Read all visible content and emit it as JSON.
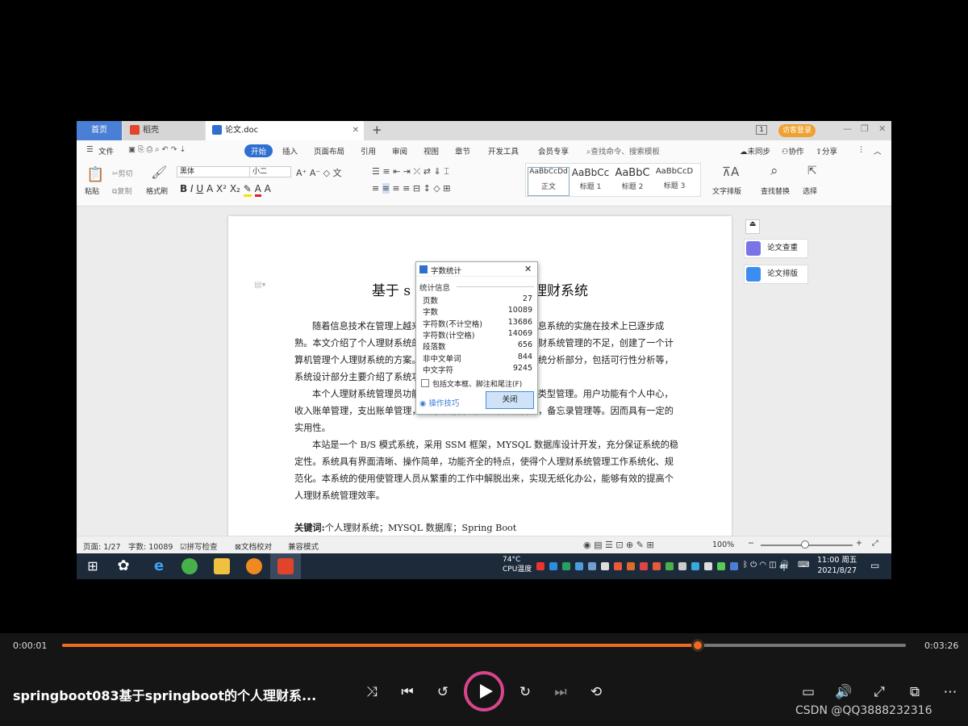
{
  "tabs": {
    "home": "首页",
    "daoke": "稻壳",
    "doc": "论文.doc",
    "login": "访客登录"
  },
  "menu": [
    "文件",
    "开始",
    "插入",
    "页面布局",
    "引用",
    "审阅",
    "视图",
    "章节",
    "开发工具",
    "会员专享"
  ],
  "menu_search": "查找命令、搜索模板",
  "menu_right": {
    "sync": "未同步",
    "collab": "协作",
    "share": "分享"
  },
  "ribbon": {
    "paste": "粘贴",
    "cut": "剪切",
    "copy": "复制",
    "format_painter": "格式刷",
    "font": "黑体",
    "size": "小二",
    "styles": [
      {
        "sample": "AaBbCcDd",
        "name": "正文"
      },
      {
        "sample": "AaBbCc",
        "name": "标题 1"
      },
      {
        "sample": "AaBbC",
        "name": "标题 2"
      },
      {
        "sample": "AaBbCcD",
        "name": "标题 3"
      }
    ],
    "text_layout": "文字排版",
    "find_replace": "查找替换",
    "select": "选择"
  },
  "document": {
    "title_left": "基于 s",
    "title_right": "理财系统",
    "p1": "随着信息技术在管理上越来越深入而广泛的应用，管理信息系统的实施在技术上已逐步成熟。本文介绍了个人理财系统的开发全过程。通过分析个人理财系统管理的不足，创建了一个计算机管理个人理财系统的方案。文章介绍了个人理财系统的系统分析部分，包括可行性分析等，系统设计部分主要介绍了系统功能设计和数据库设计。",
    "p2": "本个人理财系统管理员功能有个人中心，用户管理，账单类型管理。用户功能有个人中心，收入账单管理，支出账单管理，理财计划管理，统计分析管理，备忘录管理等。因而具有一定的实用性。",
    "p3": "本站是一个 B/S 模式系统，采用 SSM 框架，MYSQL 数据库设计开发，充分保证系统的稳定性。系统具有界面清晰、操作简单，功能齐全的特点，使得个人理财系统管理工作系统化、规范化。本系统的使用使管理人员从繁重的工作中解脱出来，实现无纸化办公，能够有效的提高个人理财系统管理效率。",
    "keywords_label": "关键词:",
    "keywords": "个人理财系统；MYSQL 数据库；Spring Boot"
  },
  "dialog": {
    "title": "字数统计",
    "section": "统计信息",
    "rows": [
      {
        "k": "页数",
        "v": "27"
      },
      {
        "k": "字数",
        "v": "10089"
      },
      {
        "k": "字符数(不计空格)",
        "v": "13686"
      },
      {
        "k": "字符数(计空格)",
        "v": "14069"
      },
      {
        "k": "段落数",
        "v": "656"
      },
      {
        "k": "非中文单词",
        "v": "844"
      },
      {
        "k": "中文字符",
        "v": "9245"
      }
    ],
    "checkbox": "包括文本框、脚注和尾注(F)",
    "tips": "操作技巧",
    "close": "关闭"
  },
  "side": {
    "check": "论文查重",
    "layout": "论文排版"
  },
  "status": {
    "page": "页面: 1/27",
    "words": "字数: 10089",
    "spell": "拼写检查",
    "proof": "文档校对",
    "compat": "兼容模式",
    "zoom": "100%"
  },
  "taskbar": {
    "temp": "74°C",
    "cpu": "CPU温度",
    "ime": "中",
    "time": "11:00 周五",
    "date": "2021/8/27"
  },
  "player": {
    "current": "0:00:01",
    "total": "0:03:26",
    "progress": 0.753,
    "title": "springboot083基于springboot的个人理财系...",
    "watermark": "CSDN @QQ3888232316"
  },
  "colors": {
    "accent": "#f06a1f",
    "play_ring": "#d8458c",
    "wps_blue": "#2f6fd0"
  }
}
